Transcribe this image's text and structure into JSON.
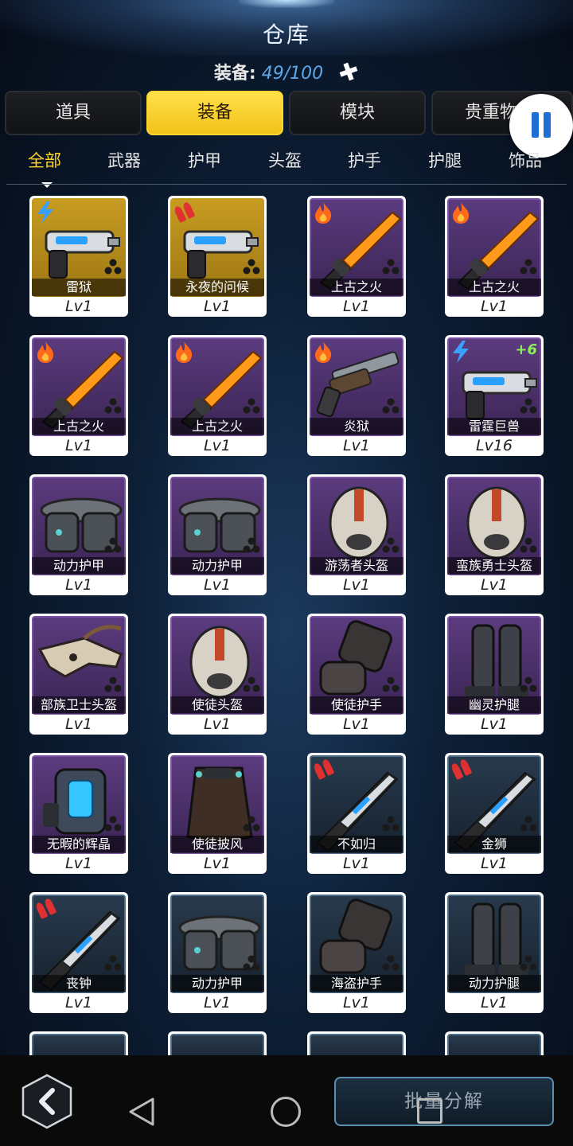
{
  "header": {
    "title": "仓库"
  },
  "capacity": {
    "label": "装备:",
    "value": "49/100",
    "icon": "plus-sort-icon"
  },
  "tabs": [
    {
      "label": "道具",
      "active": false
    },
    {
      "label": "装备",
      "active": true
    },
    {
      "label": "模块",
      "active": false
    },
    {
      "label": "贵重物",
      "active": false
    }
  ],
  "pause_button": {
    "icon": "pause-icon",
    "color": "#1d6fd6"
  },
  "subtabs": [
    {
      "label": "全部",
      "active": true
    },
    {
      "label": "武器",
      "active": false
    },
    {
      "label": "护甲",
      "active": false
    },
    {
      "label": "头盔",
      "active": false
    },
    {
      "label": "护手",
      "active": false
    },
    {
      "label": "护腿",
      "active": false
    },
    {
      "label": "饰品",
      "active": false
    }
  ],
  "items": [
    {
      "name": "雷狱",
      "level": "Lv1",
      "rarity": "gold",
      "element": "lightning-icon",
      "art": "gun"
    },
    {
      "name": "永夜的问候",
      "level": "Lv1",
      "rarity": "gold",
      "element": "ammo-icon",
      "art": "gun"
    },
    {
      "name": "上古之火",
      "level": "Lv1",
      "rarity": "purple",
      "element": "fire-icon",
      "art": "blade"
    },
    {
      "name": "上古之火",
      "level": "Lv1",
      "rarity": "purple",
      "element": "fire-icon",
      "art": "blade"
    },
    {
      "name": "上古之火",
      "level": "Lv1",
      "rarity": "purple",
      "element": "fire-icon",
      "art": "blade"
    },
    {
      "name": "上古之火",
      "level": "Lv1",
      "rarity": "purple",
      "element": "fire-icon",
      "art": "blade"
    },
    {
      "name": "炎狱",
      "level": "Lv1",
      "rarity": "purple",
      "element": "fire-icon",
      "art": "shotgun"
    },
    {
      "name": "雷霆巨兽",
      "level": "Lv16",
      "rarity": "purple",
      "element": "lightning-icon",
      "art": "gun",
      "plus": "+6"
    },
    {
      "name": "动力护甲",
      "level": "Lv1",
      "rarity": "purple",
      "element": "",
      "art": "armor"
    },
    {
      "name": "动力护甲",
      "level": "Lv1",
      "rarity": "purple",
      "element": "",
      "art": "armor"
    },
    {
      "name": "游荡者头盔",
      "level": "Lv1",
      "rarity": "purple",
      "element": "",
      "art": "helmet"
    },
    {
      "name": "蛮族勇士头盔",
      "level": "Lv1",
      "rarity": "purple",
      "element": "",
      "art": "helmet"
    },
    {
      "name": "部族卫士头盔",
      "level": "Lv1",
      "rarity": "purple",
      "element": "",
      "art": "skull"
    },
    {
      "name": "使徒头盔",
      "level": "Lv1",
      "rarity": "purple",
      "element": "",
      "art": "helmet"
    },
    {
      "name": "使徒护手",
      "level": "Lv1",
      "rarity": "purple",
      "element": "",
      "art": "glove"
    },
    {
      "name": "幽灵护腿",
      "level": "Lv1",
      "rarity": "purple",
      "element": "",
      "art": "legs"
    },
    {
      "name": "无暇的辉晶",
      "level": "Lv1",
      "rarity": "purple",
      "element": "",
      "art": "core"
    },
    {
      "name": "使徒披风",
      "level": "Lv1",
      "rarity": "purple",
      "element": "",
      "art": "cape"
    },
    {
      "name": "不如归",
      "level": "Lv1",
      "rarity": "blue",
      "element": "ammo-icon",
      "art": "rifle"
    },
    {
      "name": "金狮",
      "level": "Lv1",
      "rarity": "blue",
      "element": "ammo-icon",
      "art": "rifle"
    },
    {
      "name": "丧钟",
      "level": "Lv1",
      "rarity": "blue",
      "element": "ammo-icon",
      "art": "rifle"
    },
    {
      "name": "动力护甲",
      "level": "Lv1",
      "rarity": "blue",
      "element": "",
      "art": "armor"
    },
    {
      "name": "海盗护手",
      "level": "Lv1",
      "rarity": "blue",
      "element": "",
      "art": "glove"
    },
    {
      "name": "动力护腿",
      "level": "Lv1",
      "rarity": "blue",
      "element": "",
      "art": "legs"
    }
  ],
  "partial_items": [
    {
      "rarity": "blue"
    },
    {
      "rarity": "blue"
    },
    {
      "rarity": "blue"
    },
    {
      "rarity": "blue"
    }
  ],
  "footer": {
    "back_icon": "chevron-left-icon",
    "batch_label": "批量分解"
  },
  "colors": {
    "accent_yellow": "#ffd429",
    "capacity_blue": "#5ea7e8",
    "plus_green": "#8cf05a",
    "fire": "#ff6a1a",
    "lightning": "#3aa0ff",
    "ammo": "#e03030"
  }
}
